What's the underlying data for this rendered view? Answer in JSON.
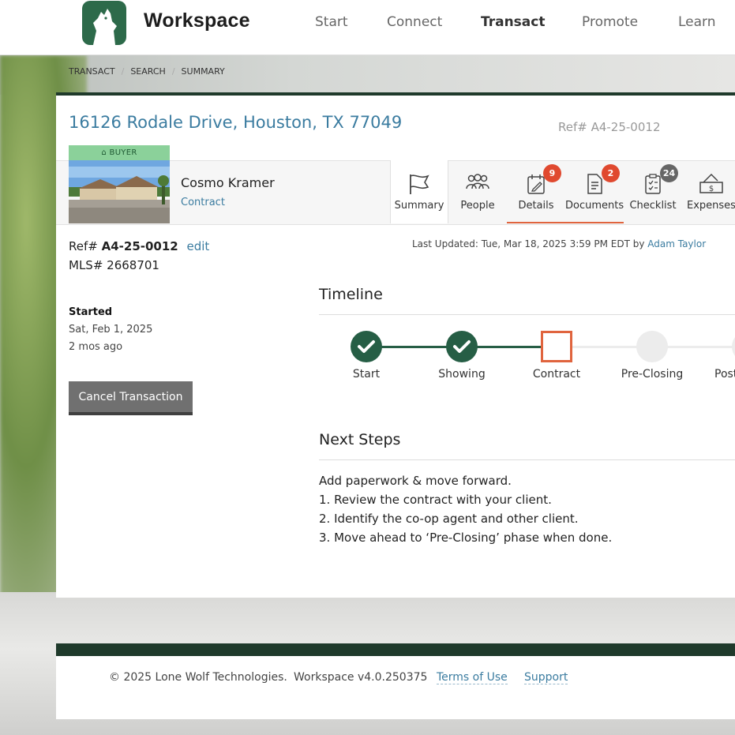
{
  "header": {
    "brand": "Workspace",
    "nav": [
      "Start",
      "Connect",
      "Transact",
      "Promote",
      "Learn"
    ],
    "active_nav": "Transact"
  },
  "breadcrumb": [
    "TRANSACT",
    "SEARCH",
    "SUMMARY"
  ],
  "transaction": {
    "address": "16126 Rodale Drive, Houston, TX 77049",
    "ref_header": "Ref# A4-25-0012",
    "side_tag": "BUYER",
    "client_name": "Cosmo Kramer",
    "client_stage": "Contract",
    "ref_label": "Ref#",
    "ref_value": "A4-25-0012",
    "edit_label": "edit",
    "mls": "MLS# 2668701",
    "last_updated": "Last Updated: Tue, Mar 18, 2025 3:59 PM EDT by",
    "updated_by": "Adam Taylor",
    "started_heading": "Started",
    "started_date": "Sat, Feb 1, 2025",
    "started_ago": "2 mos ago",
    "cancel_label": "Cancel Transaction"
  },
  "tabs": {
    "summary": {
      "label": "Summary"
    },
    "people": {
      "label": "People"
    },
    "details": {
      "label": "Details",
      "badge": "9"
    },
    "documents": {
      "label": "Documents",
      "badge": "2"
    },
    "checklist": {
      "label": "Checklist",
      "badge": "24"
    },
    "expenses": {
      "label": "Expenses"
    }
  },
  "timeline": {
    "title": "Timeline",
    "phases": [
      {
        "label": "Start",
        "status": "done"
      },
      {
        "label": "Showing",
        "status": "done"
      },
      {
        "label": "Contract",
        "status": "current"
      },
      {
        "label": "Pre-Closing",
        "status": "future"
      },
      {
        "label": "Post",
        "status": "future"
      }
    ]
  },
  "next_steps": {
    "title": "Next Steps",
    "lines": [
      "Add paperwork & move forward.",
      "1. Review the contract with your client.",
      "2. Identify the co-op agent and other client.",
      "3. Move ahead to ‘Pre-Closing’ phase when done."
    ]
  },
  "footer": {
    "copyright": "© 2025 Lone Wolf Technologies.",
    "version": "Workspace v4.0.250375",
    "terms": "Terms of Use",
    "support": "Support"
  },
  "colors": {
    "brand_green": "#265e45",
    "link_blue": "#3b7ca0",
    "accent_orange": "#e0643e",
    "badge_red": "#e0492f",
    "buyer_tag": "#8bd19a"
  }
}
